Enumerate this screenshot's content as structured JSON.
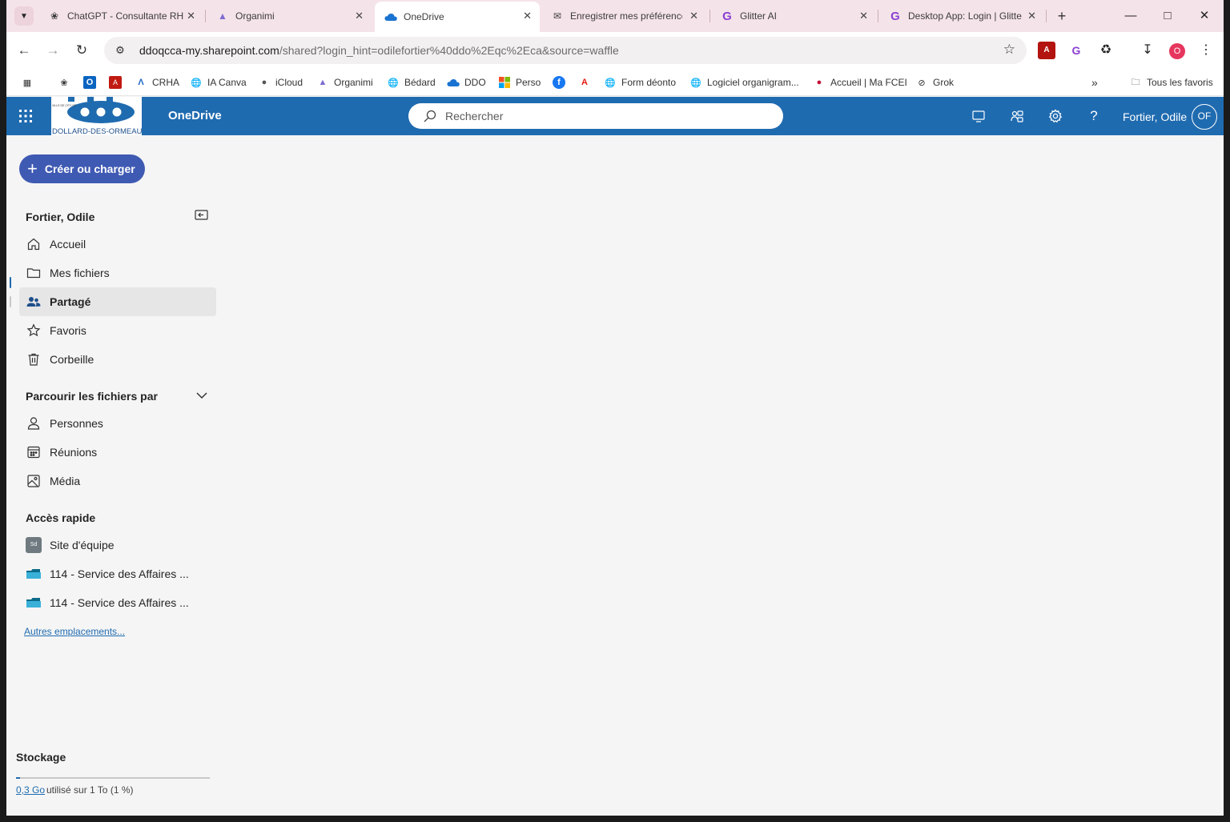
{
  "browser": {
    "tabs": [
      {
        "title": "ChatGPT - Consultante RH",
        "icon": "chatgpt-icon"
      },
      {
        "title": "Organimi",
        "icon": "organimi-icon"
      },
      {
        "title": "OneDrive",
        "icon": "onedrive-icon",
        "active": true
      },
      {
        "title": "Enregistrer mes préférences",
        "icon": "mail-icon"
      },
      {
        "title": "Glitter AI",
        "icon": "glitter-icon"
      },
      {
        "title": "Desktop App: Login | Glitter",
        "icon": "glitter-icon"
      }
    ],
    "new_tab": "+",
    "url_host": "ddoqcca-my.sharepoint.com",
    "url_path": "/shared?login_hint=odilefortier%40ddo%2Eqc%2Eca&source=waffle",
    "profile_initial": "O",
    "profile_color": "#e7365d",
    "bookmarks": [
      {
        "label": "",
        "icon": "apps-icon"
      },
      {
        "label": "",
        "icon": "chatgpt-icon"
      },
      {
        "label": "",
        "icon": "outlook-icon"
      },
      {
        "label": "",
        "icon": "pdf-icon"
      },
      {
        "label": "CRHA",
        "icon": "crha-icon"
      },
      {
        "label": "IA Canva",
        "icon": "globe-icon"
      },
      {
        "label": "iCloud",
        "icon": "apple-icon"
      },
      {
        "label": "Organimi",
        "icon": "organimi-icon"
      },
      {
        "label": "Bédard",
        "icon": "globe-icon"
      },
      {
        "label": "DDO",
        "icon": "onedrive-icon"
      },
      {
        "label": "Perso",
        "icon": "microsoft-icon"
      },
      {
        "label": "",
        "icon": "facebook-icon"
      },
      {
        "label": "",
        "icon": "adobe-icon"
      },
      {
        "label": "Form déonto",
        "icon": "globe-icon"
      },
      {
        "label": "Logiciel organigram...",
        "icon": "globe-icon"
      },
      {
        "label": "Accueil | Ma FCEI",
        "icon": "fcei-icon"
      },
      {
        "label": "Grok",
        "icon": "grok-icon"
      }
    ],
    "all_bookmarks": "Tous les favoris"
  },
  "app": {
    "name": "OneDrive",
    "logo_text": "DOLLARD-DES-ORMEAUX",
    "logo_small": "VILLE DE CITY OF",
    "search_placeholder": "Rechercher",
    "user_name": "Fortier, Odile",
    "user_initials": "OF",
    "brand_color": "#1f6bb0"
  },
  "nav": {
    "create_button": "Créer ou charger",
    "owner": "Fortier, Odile",
    "items": [
      {
        "label": "Accueil",
        "icon": "home-icon"
      },
      {
        "label": "Mes fichiers",
        "icon": "folder-icon"
      },
      {
        "label": "Partagé",
        "icon": "people-icon",
        "selected": true
      },
      {
        "label": "Favoris",
        "icon": "star-icon"
      },
      {
        "label": "Corbeille",
        "icon": "trash-icon"
      }
    ],
    "browse_title": "Parcourir les fichiers par",
    "browse_items": [
      {
        "label": "Personnes",
        "icon": "person-icon"
      },
      {
        "label": "Réunions",
        "icon": "calendar-icon"
      },
      {
        "label": "Média",
        "icon": "image-icon"
      }
    ],
    "quick_access_title": "Accès rapide",
    "quick_access": [
      {
        "label": "Site d'équipe",
        "badge": "Sd"
      },
      {
        "label": "114 - Service des Affaires ...",
        "icon": "sharepoint-library-icon"
      },
      {
        "label": "114 - Service des Affaires ...",
        "icon": "sharepoint-library-icon"
      }
    ],
    "more_locations": "Autres emplacements...",
    "storage_title": "Stockage",
    "storage_used": "0,3 Go",
    "storage_rest": "utilisé sur 1 To (1 %)",
    "storage_fraction": 0.01
  }
}
